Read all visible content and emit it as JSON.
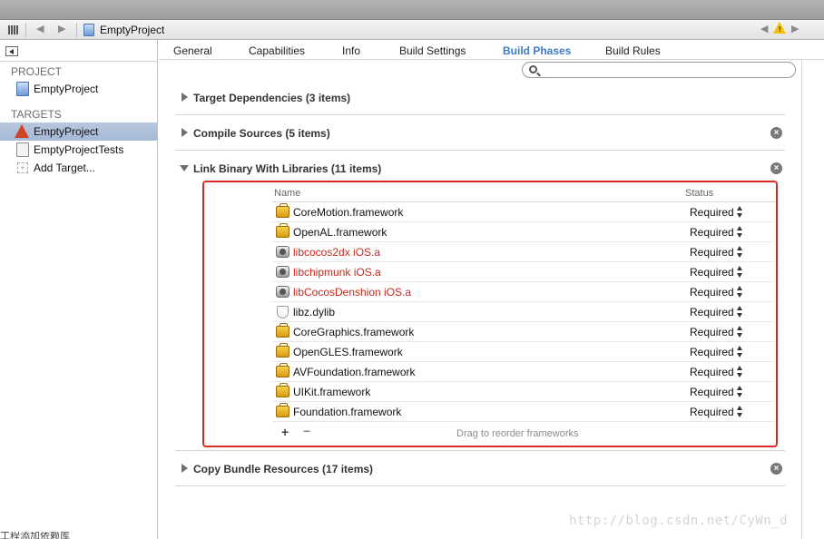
{
  "window": {
    "title": "EmptyProject"
  },
  "jumpbar": {
    "back_icon": "back-arrow-icon",
    "forward_icon": "forward-arrow-icon",
    "file_name": "EmptyProject",
    "warning_icon": "warning-icon"
  },
  "sidebar": {
    "project_header": "PROJECT",
    "project_item": "EmptyProject",
    "targets_header": "TARGETS",
    "targets": [
      {
        "label": "EmptyProject",
        "icon": "app-target-icon",
        "selected": true
      },
      {
        "label": "EmptyProjectTests",
        "icon": "test-target-icon",
        "selected": false
      },
      {
        "label": "Add Target...",
        "icon": "add-target-icon",
        "selected": false
      }
    ]
  },
  "tabs": [
    {
      "label": "General",
      "active": false
    },
    {
      "label": "Capabilities",
      "active": false
    },
    {
      "label": "Info",
      "active": false
    },
    {
      "label": "Build Settings",
      "active": false
    },
    {
      "label": "Build Phases",
      "active": true
    },
    {
      "label": "Build Rules",
      "active": false
    }
  ],
  "search": {
    "placeholder": ""
  },
  "phases": {
    "target_dependencies": "Target Dependencies (3 items)",
    "compile_sources": "Compile Sources (5 items)",
    "link_binary": "Link Binary With Libraries (11 items)",
    "copy_bundle": "Copy Bundle Resources (17 items)"
  },
  "libraries": {
    "col_name": "Name",
    "col_status": "Status",
    "items": [
      {
        "name": "CoreMotion.framework",
        "status": "Required",
        "kind": "framework",
        "missing": false
      },
      {
        "name": "OpenAL.framework",
        "status": "Required",
        "kind": "framework",
        "missing": false
      },
      {
        "name": "libcocos2dx iOS.a",
        "status": "Required",
        "kind": "archive",
        "missing": true
      },
      {
        "name": "libchipmunk iOS.a",
        "status": "Required",
        "kind": "archive",
        "missing": true
      },
      {
        "name": "libCocosDenshion iOS.a",
        "status": "Required",
        "kind": "archive",
        "missing": true
      },
      {
        "name": "libz.dylib",
        "status": "Required",
        "kind": "dylib",
        "missing": false
      },
      {
        "name": "CoreGraphics.framework",
        "status": "Required",
        "kind": "framework",
        "missing": false
      },
      {
        "name": "OpenGLES.framework",
        "status": "Required",
        "kind": "framework",
        "missing": false
      },
      {
        "name": "AVFoundation.framework",
        "status": "Required",
        "kind": "framework",
        "missing": false
      },
      {
        "name": "UIKit.framework",
        "status": "Required",
        "kind": "framework",
        "missing": false
      },
      {
        "name": "Foundation.framework",
        "status": "Required",
        "kind": "framework",
        "missing": false
      }
    ],
    "add_label": "+",
    "remove_label": "−",
    "footer_hint": "Drag to reorder frameworks"
  },
  "colors": {
    "accent": "#3f79c6",
    "missing_text": "#c7271b",
    "highlight_box": "#d62a24",
    "selection": "#a6b9d6"
  },
  "watermark": "http://blog.csdn.net/CyWn_d",
  "bottom_text": "工程添加依赖库"
}
